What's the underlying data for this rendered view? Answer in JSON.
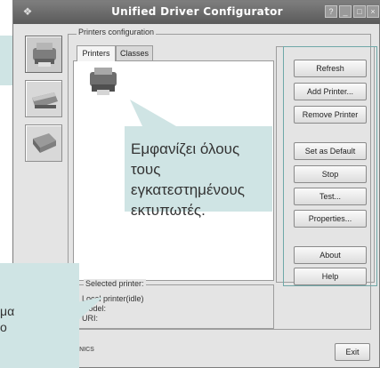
{
  "window": {
    "title": "Unified Driver Configurator",
    "controls": [
      "?",
      "_",
      "□",
      "×"
    ]
  },
  "sidebar": {
    "items": [
      {
        "name": "printer-configuration",
        "active": true
      },
      {
        "name": "scanner-configuration",
        "active": false
      },
      {
        "name": "ports-configuration",
        "active": false
      }
    ]
  },
  "group": {
    "title": "Printers configuration"
  },
  "tabs": [
    {
      "label": "Printers",
      "active": true
    },
    {
      "label": "Classes",
      "active": false
    }
  ],
  "buttons": {
    "refresh": "Refresh",
    "add_printer": "Add Printer...",
    "remove_printer": "Remove Printer",
    "set_default": "Set as Default",
    "stop": "Stop",
    "test": "Test...",
    "properties": "Properties...",
    "about": "About",
    "help": "Help",
    "exit": "Exit"
  },
  "selected_printer": {
    "label": "Selected printer:",
    "line1": "Local printer(idle)",
    "line2": "Model:",
    "line3": "URI:"
  },
  "callouts": {
    "main": "Εμφανίζει όλους τους εγκατεστημένους εκτυπωτές.",
    "left_line1": "μα",
    "left_line2": "ο"
  },
  "brand": "SAMSUNG ELECTRONICS",
  "colors": {
    "callout_bg": "#cfe4e4",
    "titlebar": "#6a6a6a",
    "window_bg": "#e4e4e4"
  }
}
